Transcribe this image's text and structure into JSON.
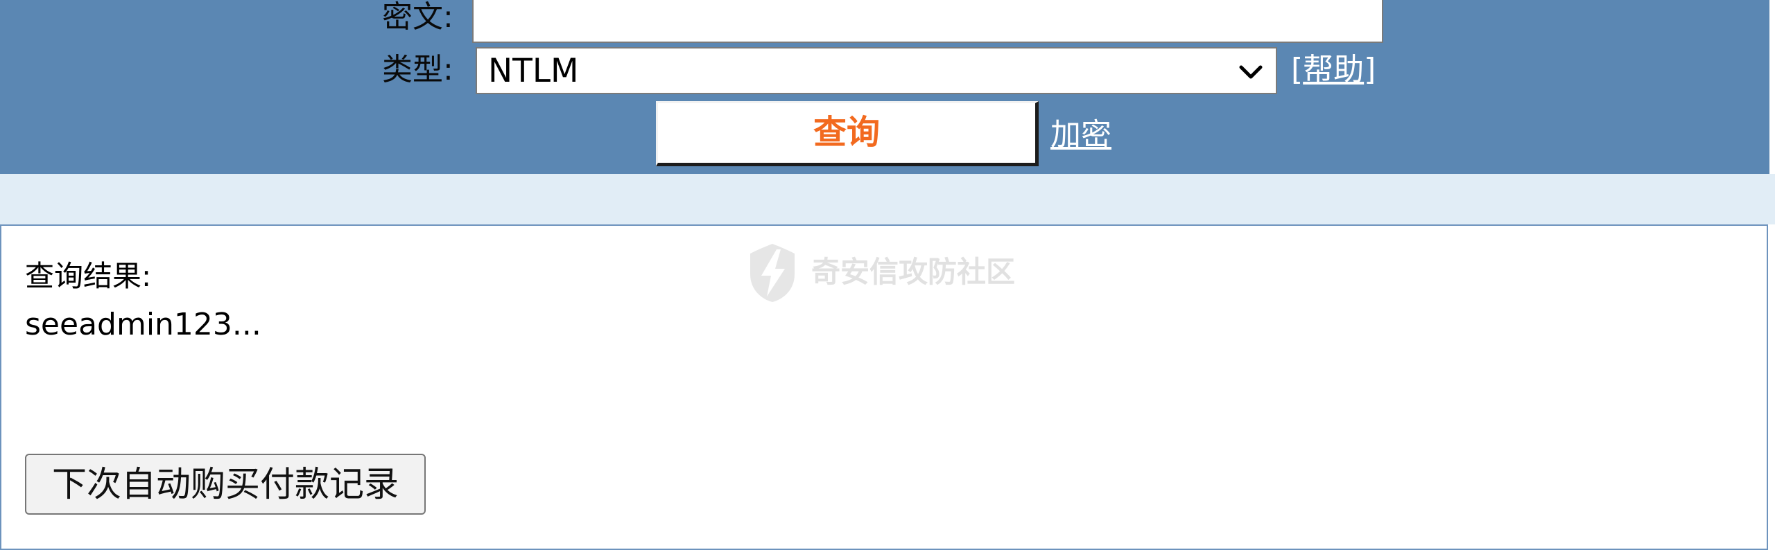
{
  "form": {
    "ciphertext_label": "密文:",
    "ciphertext_value": "",
    "type_label": "类型:",
    "type_selected": "NTLM",
    "help_open": "[",
    "help_label": "帮助",
    "help_close": "]",
    "query_button": "查询",
    "encrypt_link": "加密"
  },
  "result": {
    "label": "查询结果:",
    "value": "seeadmin123...",
    "next_purchase_button": "下次自动购买付款记录"
  },
  "watermark": {
    "text": "奇安信攻防社区"
  },
  "colors": {
    "form_background": "#5b87b3",
    "band_background": "#e1edf6",
    "result_border": "#6d93bd",
    "query_text": "#f26a1f",
    "link_text": "#ffffff"
  },
  "icons": {
    "select_arrow": "chevron-down-icon",
    "watermark_logo": "qianxin-lightning-shield-logo"
  }
}
